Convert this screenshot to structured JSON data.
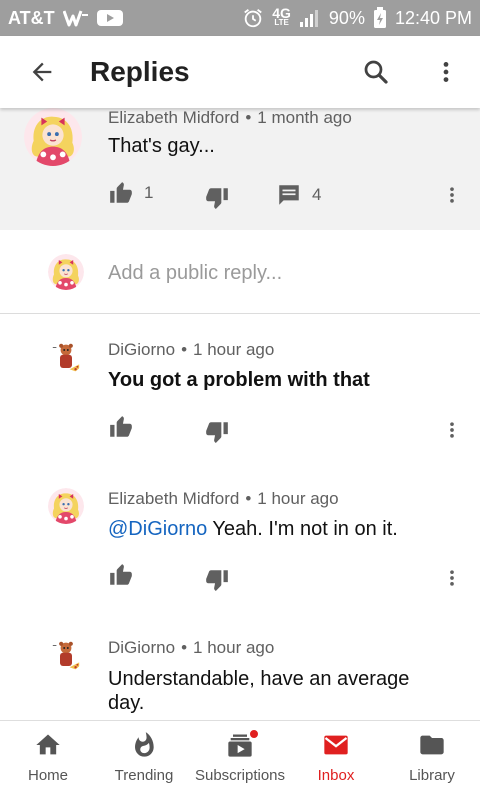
{
  "status_bar": {
    "carrier": "AT&T",
    "network": "4G",
    "network_sub": "LTE",
    "battery": "90%",
    "time": "12:40 PM"
  },
  "app_bar": {
    "title": "Replies"
  },
  "parent_comment": {
    "author": "Elizabeth Midford",
    "separator": "•",
    "age": "1 month ago",
    "text": "That's gay...",
    "likes": "1",
    "replies": "4"
  },
  "reply_input": {
    "placeholder": "Add a public reply..."
  },
  "replies": [
    {
      "author": "DiGiorno",
      "separator": "•",
      "age": "1 hour ago",
      "text": "You got a problem with that"
    },
    {
      "author": "Elizabeth Midford",
      "separator": "•",
      "age": "1 hour ago",
      "mention": "@DiGiorno",
      "text": "Yeah. I'm not in on it."
    },
    {
      "author": "DiGiorno",
      "separator": "•",
      "age": "1 hour ago",
      "text_line1": "Understandable, have an average",
      "text_line2": "day."
    }
  ],
  "bottom_nav": {
    "items": [
      {
        "label": "Home",
        "icon": "home-icon"
      },
      {
        "label": "Trending",
        "icon": "flame-icon"
      },
      {
        "label": "Subscriptions",
        "icon": "subscriptions-icon"
      },
      {
        "label": "Inbox",
        "icon": "mail-icon"
      },
      {
        "label": "Library",
        "icon": "folder-icon"
      }
    ],
    "active": "Inbox"
  },
  "colors": {
    "accent": "#e02020",
    "mention": "#1565c0",
    "status_bar": "#9e9e9e",
    "parent_bg": "#f2f2f2"
  }
}
